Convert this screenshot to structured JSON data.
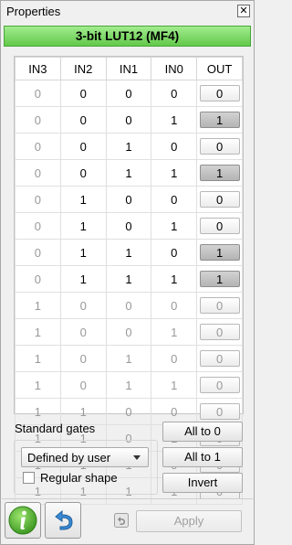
{
  "panel": {
    "title": "Properties",
    "close_label": "✕"
  },
  "header": {
    "title": "3-bit LUT12 (MF4)",
    "accent": "#62c94a"
  },
  "table": {
    "columns": [
      "IN3",
      "IN2",
      "IN1",
      "IN0",
      "OUT"
    ],
    "rows": [
      {
        "in3": "0",
        "in2": "0",
        "in1": "0",
        "in0": "0",
        "out": "0",
        "pressed": false,
        "dim": false
      },
      {
        "in3": "0",
        "in2": "0",
        "in1": "0",
        "in0": "1",
        "out": "1",
        "pressed": true,
        "dim": false
      },
      {
        "in3": "0",
        "in2": "0",
        "in1": "1",
        "in0": "0",
        "out": "0",
        "pressed": false,
        "dim": false
      },
      {
        "in3": "0",
        "in2": "0",
        "in1": "1",
        "in0": "1",
        "out": "1",
        "pressed": true,
        "dim": false
      },
      {
        "in3": "0",
        "in2": "1",
        "in1": "0",
        "in0": "0",
        "out": "0",
        "pressed": false,
        "dim": false
      },
      {
        "in3": "0",
        "in2": "1",
        "in1": "0",
        "in0": "1",
        "out": "0",
        "pressed": false,
        "dim": false
      },
      {
        "in3": "0",
        "in2": "1",
        "in1": "1",
        "in0": "0",
        "out": "1",
        "pressed": true,
        "dim": false
      },
      {
        "in3": "0",
        "in2": "1",
        "in1": "1",
        "in0": "1",
        "out": "1",
        "pressed": true,
        "dim": false
      },
      {
        "in3": "1",
        "in2": "0",
        "in1": "0",
        "in0": "0",
        "out": "0",
        "pressed": false,
        "dim": true
      },
      {
        "in3": "1",
        "in2": "0",
        "in1": "0",
        "in0": "1",
        "out": "0",
        "pressed": false,
        "dim": true
      },
      {
        "in3": "1",
        "in2": "0",
        "in1": "1",
        "in0": "0",
        "out": "0",
        "pressed": false,
        "dim": true
      },
      {
        "in3": "1",
        "in2": "0",
        "in1": "1",
        "in0": "1",
        "out": "0",
        "pressed": false,
        "dim": true
      },
      {
        "in3": "1",
        "in2": "1",
        "in1": "0",
        "in0": "0",
        "out": "0",
        "pressed": false,
        "dim": true
      },
      {
        "in3": "1",
        "in2": "1",
        "in1": "0",
        "in0": "1",
        "out": "0",
        "pressed": false,
        "dim": true
      },
      {
        "in3": "1",
        "in2": "1",
        "in1": "1",
        "in0": "0",
        "out": "0",
        "pressed": false,
        "dim": true
      },
      {
        "in3": "1",
        "in2": "1",
        "in1": "1",
        "in0": "1",
        "out": "0",
        "pressed": false,
        "dim": true
      }
    ]
  },
  "standard_gates": {
    "label": "Standard gates",
    "selected": "Defined by user",
    "regular_shape_label": "Regular shape",
    "regular_shape_checked": false
  },
  "buttons": {
    "all_to_0": "All to 0",
    "all_to_1": "All to 1",
    "invert": "Invert",
    "apply": "Apply"
  },
  "icons": {
    "info": "info-icon",
    "undo": "undo-arrow-icon",
    "revert": "revert-icon"
  }
}
